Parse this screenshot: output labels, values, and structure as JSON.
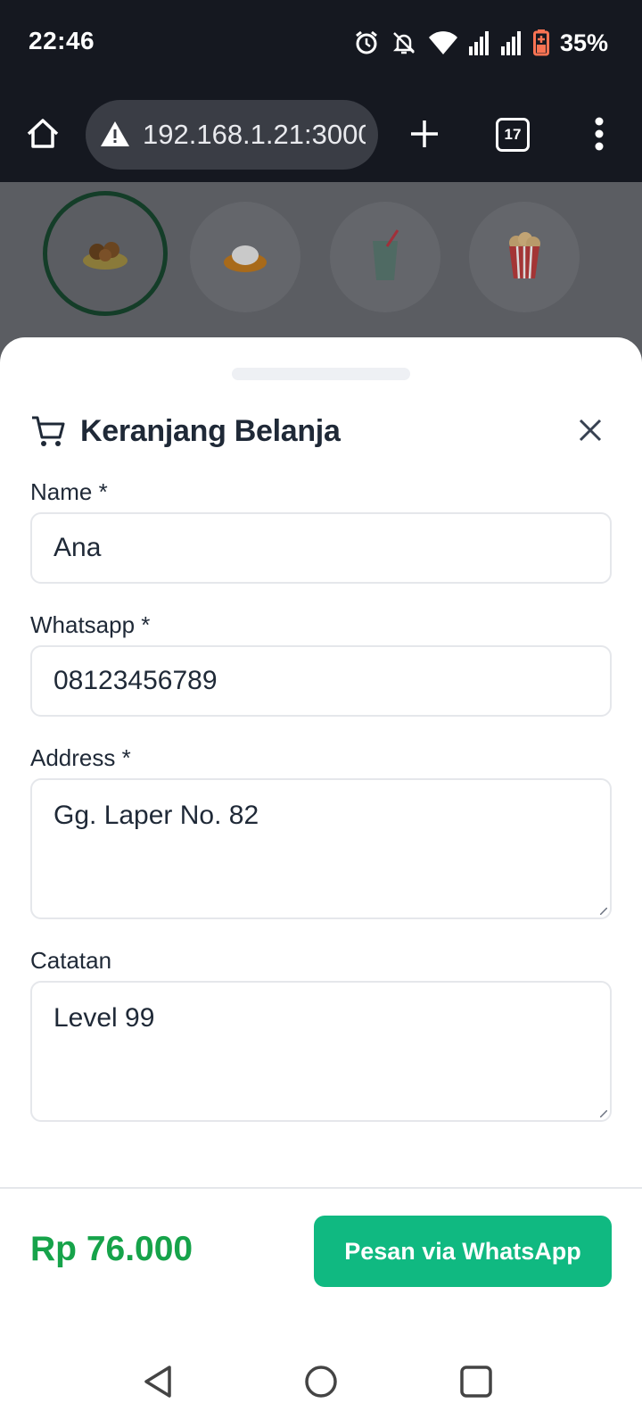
{
  "status": {
    "time": "22:46",
    "battery": "35%",
    "icons": [
      "alarm-icon",
      "bell-off-icon",
      "wifi-icon",
      "signal-icon",
      "signal-icon",
      "battery-saver-icon"
    ]
  },
  "browser": {
    "url": "192.168.1.21:3000/",
    "tab_count": "17",
    "icons": [
      "home-icon",
      "warning-icon",
      "plus-icon",
      "tabs-icon",
      "more-vert-icon"
    ]
  },
  "categories": [
    {
      "icon": "food-plate-icon",
      "active": true
    },
    {
      "icon": "rice-bowl-icon",
      "active": false
    },
    {
      "icon": "drink-icon",
      "active": false
    },
    {
      "icon": "popcorn-icon",
      "active": false
    }
  ],
  "cart": {
    "title": "Keranjang Belanja",
    "fields": {
      "name": {
        "label": "Name *",
        "value": "Ana"
      },
      "whatsapp": {
        "label": "Whatsapp *",
        "value": "08123456789"
      },
      "address": {
        "label": "Address *",
        "value": "Gg. Laper No. 82"
      },
      "notes": {
        "label": "Catatan",
        "value": "Level 99"
      }
    },
    "total": "Rp 76.000",
    "order_button": "Pesan via WhatsApp"
  },
  "colors": {
    "accent_green": "#16a34a",
    "button_green": "#10b981",
    "dark_bar": "#151820"
  }
}
